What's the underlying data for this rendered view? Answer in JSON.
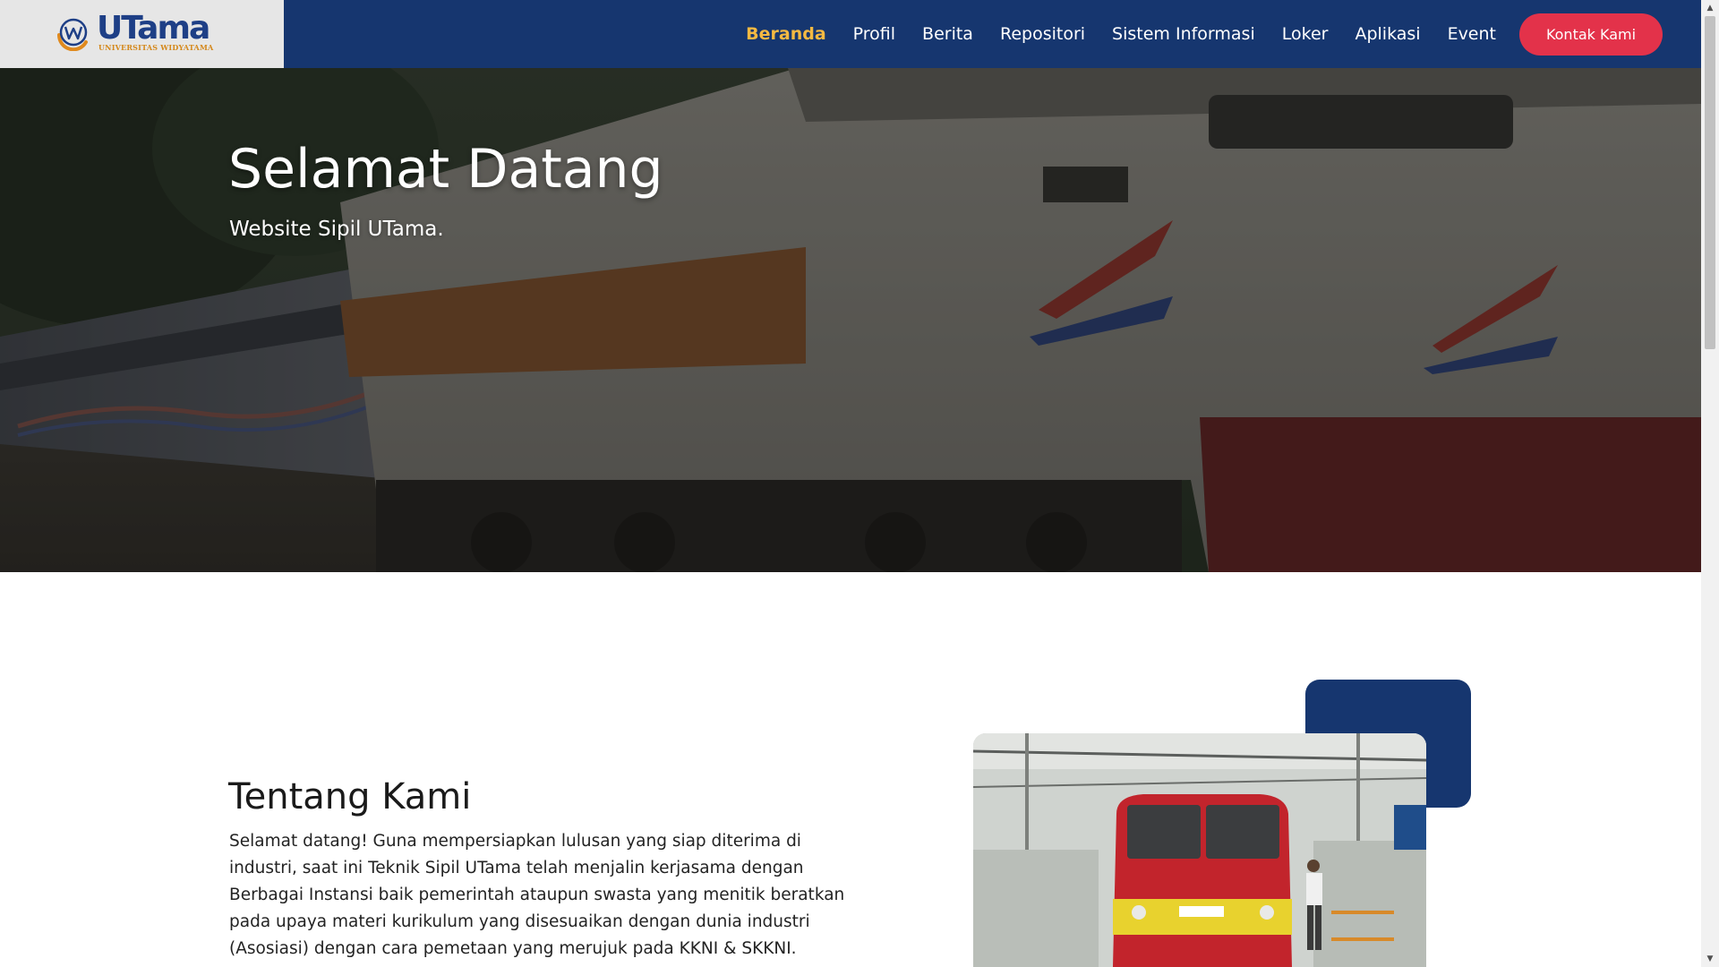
{
  "header": {
    "logo": {
      "word": "UTama",
      "subtitle": "UNIVERSITAS WIDYATAMA",
      "icon": "utama-logo-icon"
    },
    "nav": [
      {
        "label": "Beranda",
        "active": true
      },
      {
        "label": "Profil",
        "active": false
      },
      {
        "label": "Berita",
        "active": false
      },
      {
        "label": "Repositori",
        "active": false
      },
      {
        "label": "Sistem Informasi",
        "active": false
      },
      {
        "label": "Loker",
        "active": false
      },
      {
        "label": "Aplikasi",
        "active": false
      },
      {
        "label": "Event",
        "active": false
      }
    ],
    "contact_label": "Kontak Kami"
  },
  "hero": {
    "title": "Selamat Datang",
    "subtitle": "Website Sipil UTama."
  },
  "about": {
    "title": "Tentang Kami",
    "text": "Selamat datang! Guna mempersiapkan lulusan yang siap diterima di industri, saat ini Teknik Sipil UTama telah menjalin kerjasama dengan Berbagai Instansi baik pemerintah ataupun swasta yang menitik beratkan pada upaya materi kurikulum yang disesuaikan dengan dunia industri (Asosiasi) dengan cara pemetaan yang merujuk pada KKNI & SKKNI."
  },
  "colors": {
    "nav_bg": "#16366f",
    "accent_active": "#f4b942",
    "contact_button": "#e3324a",
    "deco_square": "#16366f"
  }
}
